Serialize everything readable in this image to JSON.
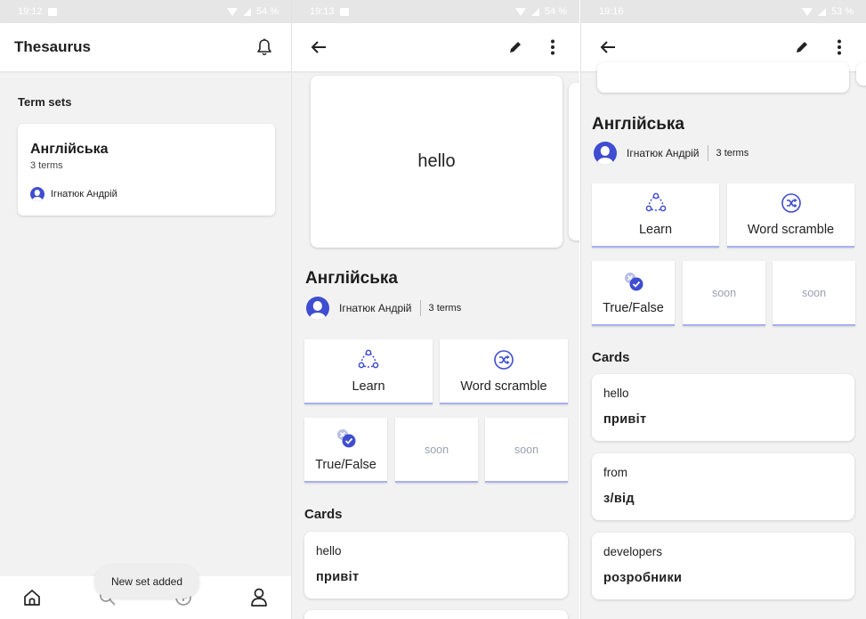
{
  "screen1": {
    "status": {
      "time": "19:12",
      "battery": "54 %"
    },
    "appbar": {
      "title": "Thesaurus"
    },
    "section_title": "Term sets",
    "set_card": {
      "name": "Англійська",
      "count": "3 terms",
      "author": "Ігнатюк Андрій"
    },
    "toast": "New set added",
    "nav": [
      "home-icon",
      "search-icon",
      "add-icon",
      "profile-icon"
    ]
  },
  "screen2": {
    "status": {
      "time": "19:13",
      "battery": "54 %"
    },
    "flashcard": {
      "text": "hello"
    },
    "set": {
      "title": "Англійська",
      "author": "Ігнатюк Андрій",
      "terms": "3 terms"
    },
    "modes": {
      "learn": "Learn",
      "scramble": "Word scramble",
      "truefalse": "True/False",
      "soon": "soon"
    },
    "cards_title": "Cards",
    "cards": [
      {
        "term": "hello",
        "definition": "привіт"
      }
    ]
  },
  "screen3": {
    "status": {
      "time": "19:16",
      "battery": "53 %"
    },
    "set": {
      "title": "Англійська",
      "author": "Ігнатюк Андрій",
      "terms": "3 terms"
    },
    "modes": {
      "learn": "Learn",
      "scramble": "Word scramble",
      "truefalse": "True/False",
      "soon": "soon"
    },
    "cards_title": "Cards",
    "cards": [
      {
        "term": "hello",
        "definition": "привіт"
      },
      {
        "term": "from",
        "definition": "з/від"
      },
      {
        "term": "developers",
        "definition": "розробники"
      }
    ]
  },
  "colors": {
    "accent": "#3e4dd1",
    "mode_underline": "#a7b0ef",
    "background": "#f2f2f2"
  }
}
